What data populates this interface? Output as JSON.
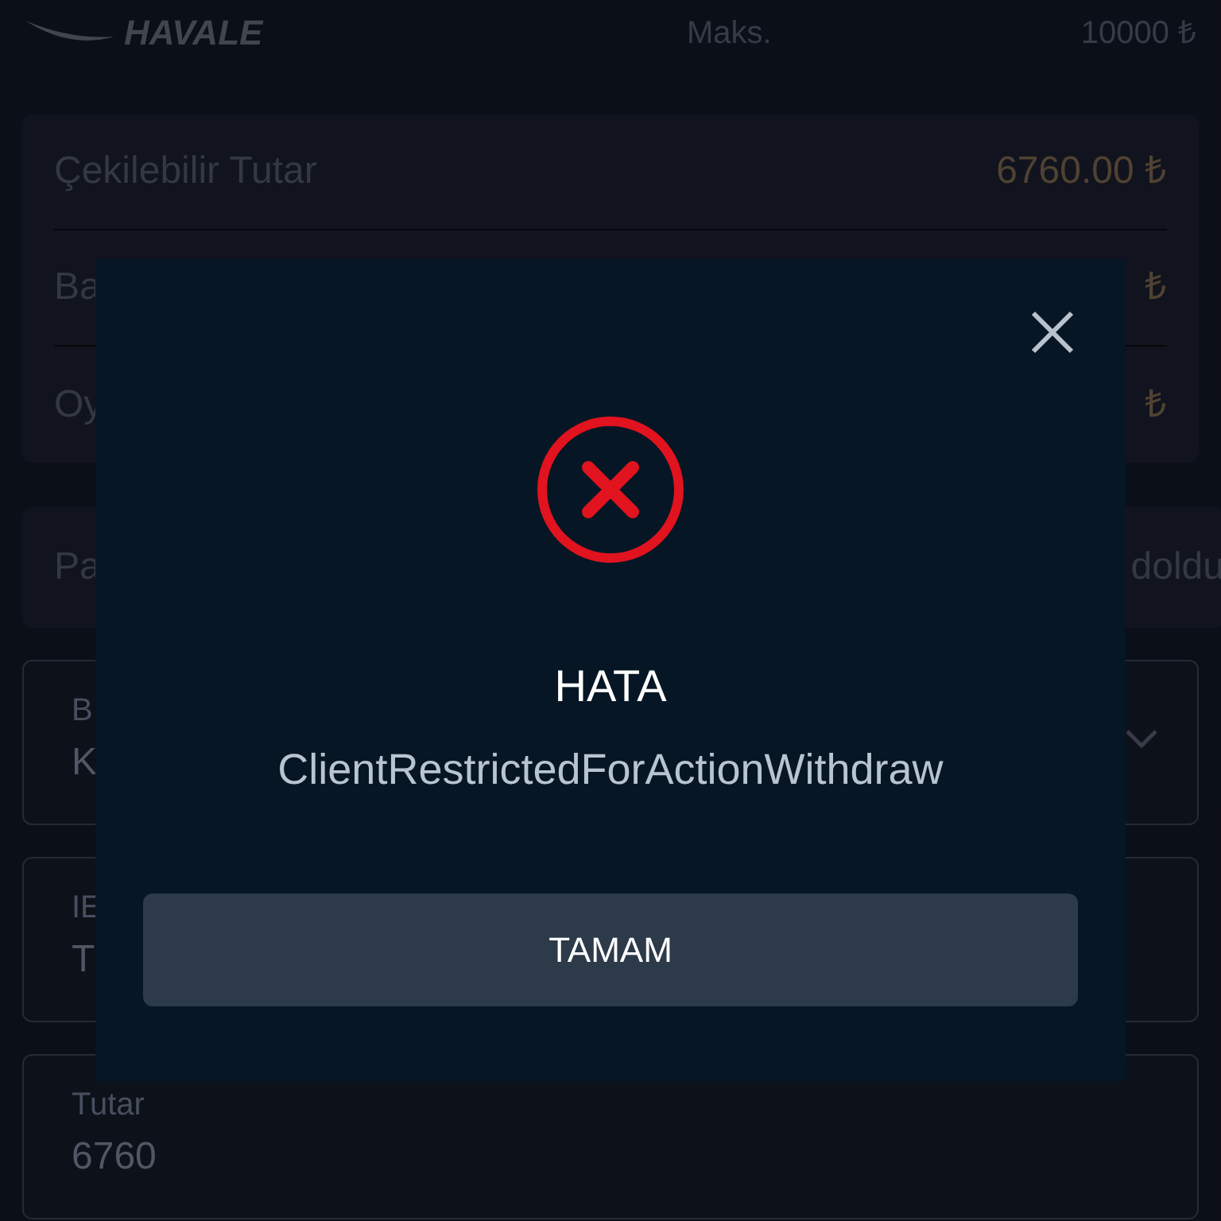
{
  "header": {
    "logo_text": "HAVALE",
    "max_label": "Maks.",
    "max_value": "10000 ₺"
  },
  "balances": [
    {
      "label": "Çekilebilir Tutar",
      "value": "6760.00 ₺"
    },
    {
      "label": "Ba",
      "value": "₺"
    },
    {
      "label": "Oy",
      "value": "₺"
    }
  ],
  "info_field": {
    "left": "Pa",
    "right": "doldu"
  },
  "fields": [
    {
      "kind": "select",
      "label": "B",
      "value": "K"
    },
    {
      "kind": "text",
      "label": "IE",
      "value": "T"
    },
    {
      "kind": "text",
      "label": "Tutar",
      "value": "6760"
    }
  ],
  "dialog": {
    "title": "HATA",
    "message": "ClientRestrictedForActionWithdraw",
    "button": "TAMAM"
  }
}
